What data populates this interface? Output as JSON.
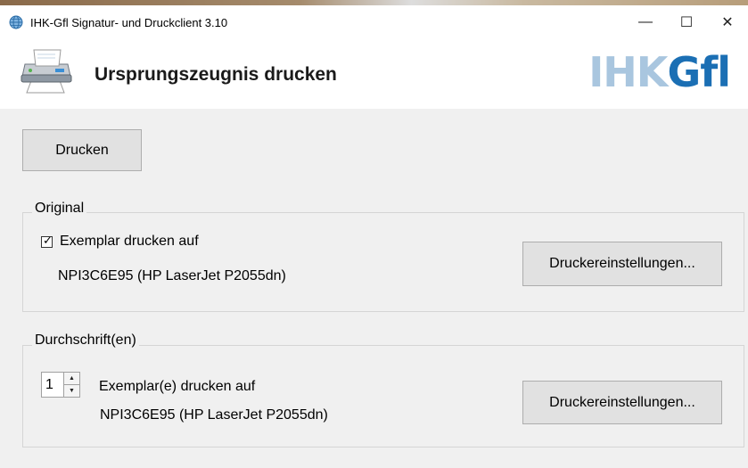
{
  "window": {
    "title": "IHK-Gfl Signatur- und Druckclient 3.10",
    "icons": {
      "app": "globe-icon",
      "minimize": "minimize-icon",
      "maximize": "maximize-icon",
      "close": "close-icon"
    },
    "controls": {
      "minimize": "—",
      "maximize": "☐",
      "close": "✕"
    }
  },
  "header": {
    "title": "Ursprungszeugnis drucken",
    "icon": "printer-icon",
    "logo": {
      "part1": "IHK",
      "part2": "G",
      "part3": "fl"
    },
    "colors": {
      "logo_light": "#a9c6df",
      "logo_dark": "#1b6fb4"
    }
  },
  "toolbar": {
    "print_label": "Drucken"
  },
  "original": {
    "legend": "Original",
    "checkbox_label": "Exemplar drucken auf",
    "checked": true,
    "printer": "NPI3C6E95 (HP LaserJet P2055dn)",
    "settings_label": "Druckereinstellungen..."
  },
  "copies": {
    "legend": "Durchschrift(en)",
    "count": "1",
    "label": "Exemplar(e) drucken auf",
    "printer": "NPI3C6E95 (HP LaserJet P2055dn)",
    "settings_label": "Druckereinstellungen..."
  }
}
